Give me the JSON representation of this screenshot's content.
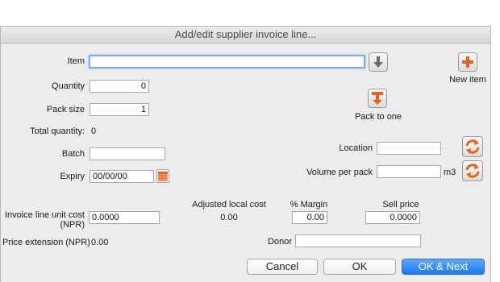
{
  "window": {
    "title": "Add/edit supplier invoice line..."
  },
  "form": {
    "item_label": "Item",
    "item_value": "",
    "quantity_label": "Quantity",
    "quantity_value": "0",
    "pack_size_label": "Pack size",
    "pack_size_value": "1",
    "total_quantity_label": "Total quantity:",
    "total_quantity_value": "0",
    "batch_label": "Batch",
    "batch_value": "",
    "expiry_label": "Expiry",
    "expiry_value": "00/00/00",
    "location_label": "Location",
    "location_value": "",
    "volume_label": "Volume per pack",
    "volume_value": "",
    "volume_unit": "m3",
    "unit_cost_label_line1": "Invoice line unit cost",
    "unit_cost_label_line2": "(NPR)",
    "unit_cost_value": "0.0000",
    "adjusted_cost_label": "Adjusted local cost",
    "adjusted_cost_value": "0.00",
    "margin_label": "% Margin",
    "margin_value": "0.00",
    "sell_price_label": "Sell price",
    "sell_price_value": "0.0000",
    "price_extension_label": "Price extension (NPR)",
    "price_extension_value": "0.00",
    "donor_label": "Donor",
    "donor_value": ""
  },
  "side": {
    "new_item_label": "New item",
    "pack_to_one_label": "Pack to one"
  },
  "buttons": {
    "cancel": "Cancel",
    "ok": "OK",
    "ok_next": "OK & Next"
  },
  "icons": {
    "item_lookup": "arrow-down-icon",
    "new_item": "plus-icon",
    "pack_to_one": "pack-to-one-icon",
    "calendar": "calendar-icon",
    "location_refresh": "refresh-icon",
    "volume_refresh": "refresh-icon"
  },
  "colors": {
    "accent_orange": "#e8621f",
    "primary_blue": "#1d79f4",
    "focus_ring": "#7eaeea"
  }
}
